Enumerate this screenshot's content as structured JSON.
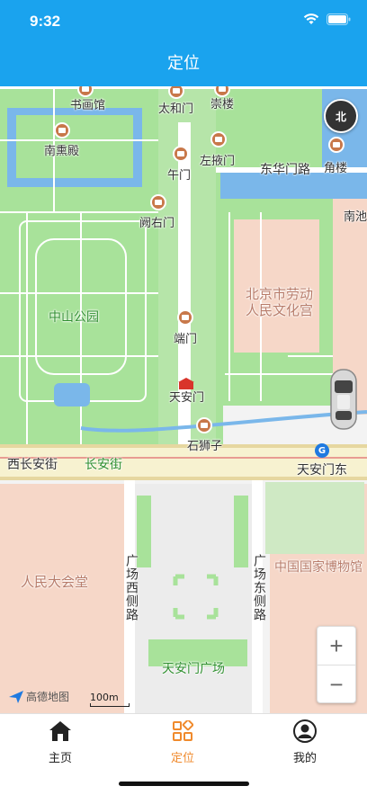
{
  "status": {
    "time": "9:32"
  },
  "nav": {
    "title": "定位"
  },
  "map": {
    "compass_label": "北",
    "zoom_in": "+",
    "zoom_out": "−",
    "logo_text": "高德地图",
    "scale_text": "100m",
    "metro_symbol": "G",
    "labels": {
      "shuhuaguan": "书画馆",
      "taihemen": "太和门",
      "chonglou": "崇楼",
      "nanxundian": "南熏殿",
      "wumen": "午门",
      "zuoyemen": "左掖门",
      "donghuamenlu": "东华门路",
      "jiaolou": "角楼",
      "queyoumen": "阙右门",
      "nanchi": "南池",
      "laodongrenmin": "北京市劳动人民文化宫",
      "zhongshan": "中山公园",
      "duanmen": "端门",
      "tiananmen": "天安门",
      "shishizi": "石狮子",
      "xichanganjie": "西长安街",
      "changanjie": "长安街",
      "tiananmendong": "天安门东",
      "renmindahuitang": "人民大会堂",
      "guangchangxi": "广场西侧路",
      "guangchangdong": "广场东侧路",
      "bowuguan": "中国国家博物馆",
      "tiananmenguangchang": "天安门广场"
    }
  },
  "tabs": [
    {
      "label": "主页",
      "icon": "home-icon",
      "active": false
    },
    {
      "label": "定位",
      "icon": "grid-icon",
      "active": true
    },
    {
      "label": "我的",
      "icon": "profile-icon",
      "active": false
    }
  ],
  "colors": {
    "primary": "#1aa3ee",
    "active_tab": "#f08a2c",
    "park_green": "#a8e29a",
    "water": "#5da9e9",
    "building": "#f6d7c8"
  }
}
